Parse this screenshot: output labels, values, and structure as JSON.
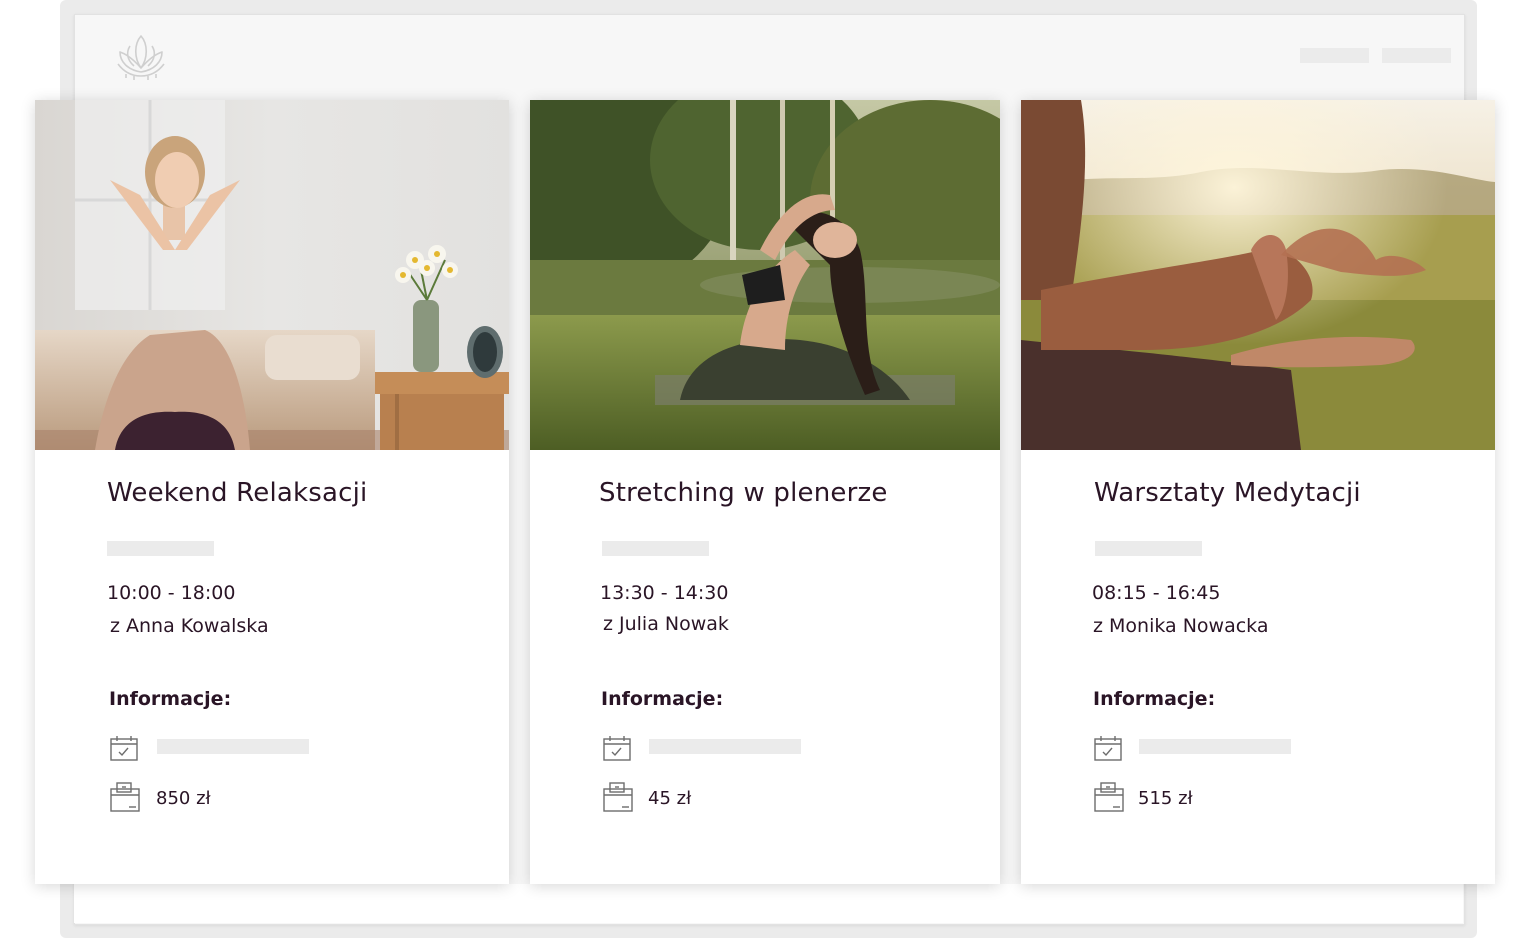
{
  "brand": {
    "logo_icon": "lotus-icon"
  },
  "info_label": "Informacje:",
  "colors": {
    "text": "#2a1526",
    "placeholder": "#ebebeb",
    "icon_stroke": "#6d6d6d"
  },
  "cards": [
    {
      "title": "Weekend Relaksacji",
      "time": "10:00 - 18:00",
      "instructor": "z Anna Kowalska",
      "price": "850 zł",
      "image": "woman-relaxing-bedroom-photo"
    },
    {
      "title": "Stretching w plenerze",
      "time": "13:30 - 14:30",
      "instructor": "z Julia Nowak",
      "price": "45 zł",
      "image": "woman-yoga-outdoor-photo"
    },
    {
      "title": "Warsztaty Medytacji",
      "time": "08:15 - 16:45",
      "instructor": "z Monika Nowacka",
      "price": "515 zł",
      "image": "meditation-hands-field-photo"
    }
  ]
}
